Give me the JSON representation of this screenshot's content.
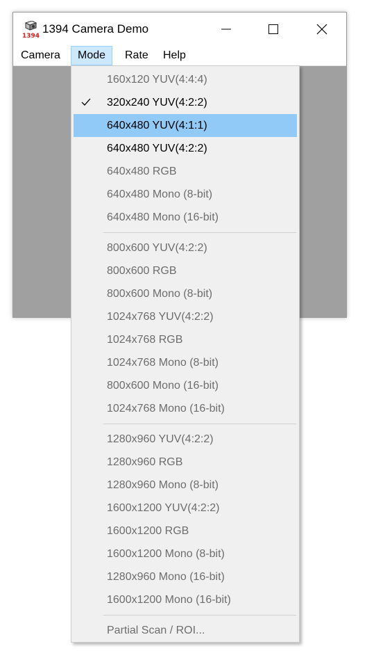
{
  "window": {
    "title": "1394 Camera Demo",
    "icon": "camera-1394-icon",
    "icon_text": "1394",
    "controls": {
      "minimize": "minimize-icon",
      "maximize": "maximize-icon",
      "close": "close-icon"
    }
  },
  "menubar": {
    "items": [
      {
        "label": "Camera",
        "active": false
      },
      {
        "label": "Mode",
        "active": true
      },
      {
        "label": "Rate",
        "active": false
      },
      {
        "label": "Help",
        "active": false
      }
    ]
  },
  "mode_menu": {
    "groups": [
      [
        {
          "label": "160x120 YUV(4:4:4)",
          "enabled": false,
          "checked": false,
          "highlighted": false
        },
        {
          "label": "320x240 YUV(4:2:2)",
          "enabled": true,
          "checked": true,
          "highlighted": false
        },
        {
          "label": "640x480 YUV(4:1:1)",
          "enabled": true,
          "checked": false,
          "highlighted": true
        },
        {
          "label": "640x480 YUV(4:2:2)",
          "enabled": true,
          "checked": false,
          "highlighted": false
        },
        {
          "label": "640x480 RGB",
          "enabled": false,
          "checked": false,
          "highlighted": false
        },
        {
          "label": "640x480 Mono (8-bit)",
          "enabled": false,
          "checked": false,
          "highlighted": false
        },
        {
          "label": "640x480 Mono (16-bit)",
          "enabled": false,
          "checked": false,
          "highlighted": false
        }
      ],
      [
        {
          "label": "800x600 YUV(4:2:2)",
          "enabled": false,
          "checked": false,
          "highlighted": false
        },
        {
          "label": "800x600 RGB",
          "enabled": false,
          "checked": false,
          "highlighted": false
        },
        {
          "label": "800x600 Mono (8-bit)",
          "enabled": false,
          "checked": false,
          "highlighted": false
        },
        {
          "label": "1024x768 YUV(4:2:2)",
          "enabled": false,
          "checked": false,
          "highlighted": false
        },
        {
          "label": "1024x768 RGB",
          "enabled": false,
          "checked": false,
          "highlighted": false
        },
        {
          "label": "1024x768 Mono (8-bit)",
          "enabled": false,
          "checked": false,
          "highlighted": false
        },
        {
          "label": "800x600 Mono (16-bit)",
          "enabled": false,
          "checked": false,
          "highlighted": false
        },
        {
          "label": "1024x768 Mono (16-bit)",
          "enabled": false,
          "checked": false,
          "highlighted": false
        }
      ],
      [
        {
          "label": "1280x960 YUV(4:2:2)",
          "enabled": false,
          "checked": false,
          "highlighted": false
        },
        {
          "label": "1280x960 RGB",
          "enabled": false,
          "checked": false,
          "highlighted": false
        },
        {
          "label": "1280x960 Mono (8-bit)",
          "enabled": false,
          "checked": false,
          "highlighted": false
        },
        {
          "label": "1600x1200 YUV(4:2:2)",
          "enabled": false,
          "checked": false,
          "highlighted": false
        },
        {
          "label": "1600x1200 RGB",
          "enabled": false,
          "checked": false,
          "highlighted": false
        },
        {
          "label": "1600x1200 Mono (8-bit)",
          "enabled": false,
          "checked": false,
          "highlighted": false
        },
        {
          "label": "1280x960 Mono (16-bit)",
          "enabled": false,
          "checked": false,
          "highlighted": false
        },
        {
          "label": "1600x1200 Mono (16-bit)",
          "enabled": false,
          "checked": false,
          "highlighted": false
        }
      ],
      [
        {
          "label": "Partial Scan / ROI...",
          "enabled": false,
          "checked": false,
          "highlighted": false
        }
      ]
    ]
  },
  "colors": {
    "client_background": "#a0a0a0",
    "menu_background": "#f0f0f0",
    "highlight": "#91c9f7",
    "active_menu": "#cce8ff",
    "disabled_text": "#6d6d6d",
    "icon_text": "#d02020"
  }
}
